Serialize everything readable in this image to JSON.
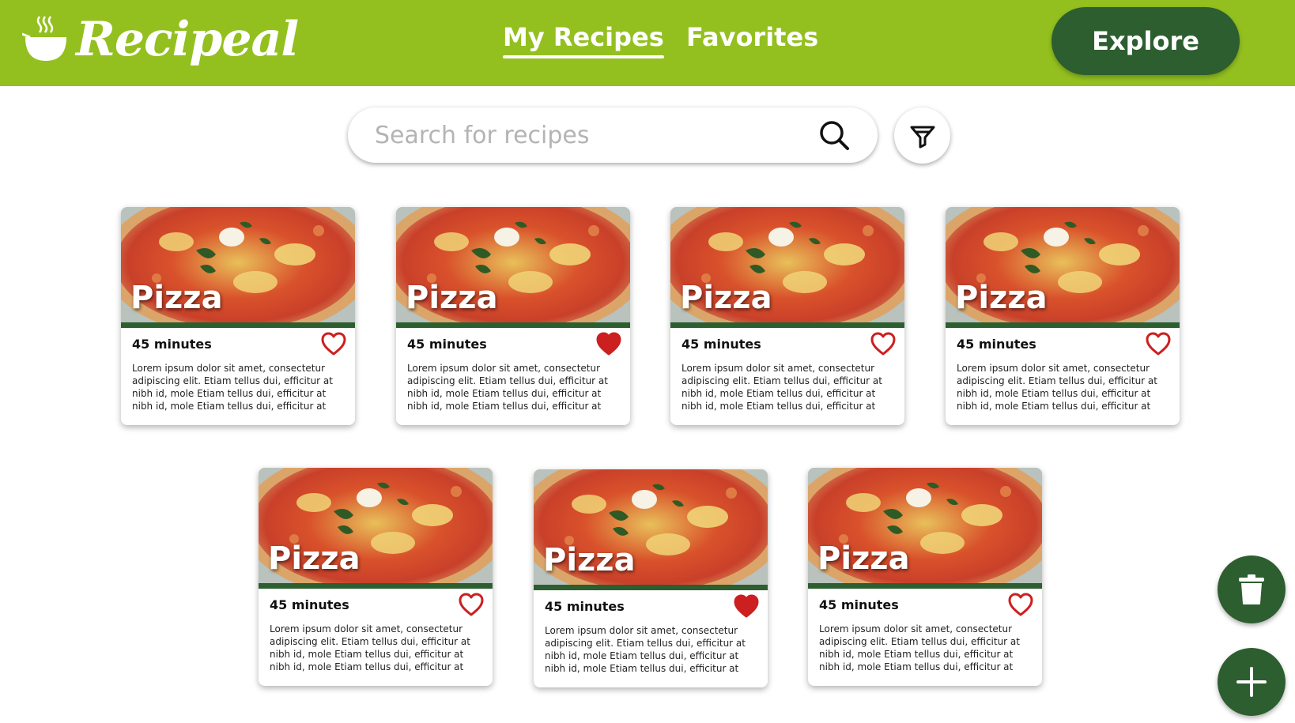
{
  "header": {
    "logo_text": "Recipeal",
    "tabs": [
      {
        "label": "My Recipes",
        "active": true
      },
      {
        "label": "Favorites",
        "active": false
      }
    ],
    "explore_label": "Explore"
  },
  "search": {
    "placeholder": "Search for recipes",
    "value": ""
  },
  "colors": {
    "brand_green": "#93c01f",
    "dark_green": "#2d5e2f",
    "heart_red": "#cc1f1f"
  },
  "cards": [
    {
      "title": "Pizza",
      "time": "45 minutes",
      "favorite": false,
      "description": "Lorem ipsum dolor sit amet, consectetur adipiscing elit. Etiam tellus dui, efficitur at nibh id, mole Etiam tellus dui, efficitur at nibh id, mole Etiam tellus dui, efficitur at nibh id, mole..."
    },
    {
      "title": "Pizza",
      "time": "45 minutes",
      "favorite": true,
      "description": "Lorem ipsum dolor sit amet, consectetur adipiscing elit. Etiam tellus dui, efficitur at nibh id, mole Etiam tellus dui, efficitur at nibh id, mole Etiam tellus dui, efficitur at nibh id, mole..."
    },
    {
      "title": "Pizza",
      "time": "45 minutes",
      "favorite": false,
      "description": "Lorem ipsum dolor sit amet, consectetur adipiscing elit. Etiam tellus dui, efficitur at nibh id, mole Etiam tellus dui, efficitur at nibh id, mole Etiam tellus dui, efficitur at nibh id, mole..."
    },
    {
      "title": "Pizza",
      "time": "45 minutes",
      "favorite": false,
      "description": "Lorem ipsum dolor sit amet, consectetur adipiscing elit. Etiam tellus dui, efficitur at nibh id, mole Etiam tellus dui, efficitur at nibh id, mole Etiam tellus dui, efficitur at nibh id, mole..."
    },
    {
      "title": "Pizza",
      "time": "45 minutes",
      "favorite": false,
      "description": "Lorem ipsum dolor sit amet, consectetur adipiscing elit. Etiam tellus dui, efficitur at nibh id, mole Etiam tellus dui, efficitur at nibh id, mole Etiam tellus dui, efficitur at nibh id, mole..."
    },
    {
      "title": "Pizza",
      "time": "45 minutes",
      "favorite": true,
      "description": "Lorem ipsum dolor sit amet, consectetur adipiscing elit. Etiam tellus dui, efficitur at nibh id, mole Etiam tellus dui, efficitur at nibh id, mole Etiam tellus dui, efficitur at nibh id, mole..."
    },
    {
      "title": "Pizza",
      "time": "45 minutes",
      "favorite": false,
      "description": "Lorem ipsum dolor sit amet, consectetur adipiscing elit. Etiam tellus dui, efficitur at nibh id, mole Etiam tellus dui, efficitur at nibh id, mole Etiam tellus dui, efficitur at nibh id, mole..."
    }
  ],
  "icons": {
    "logo": "steaming-bowl-icon",
    "search": "search-icon",
    "filter": "funnel-icon",
    "delete": "trash-icon",
    "add": "plus-icon",
    "favorite": "heart-icon"
  }
}
